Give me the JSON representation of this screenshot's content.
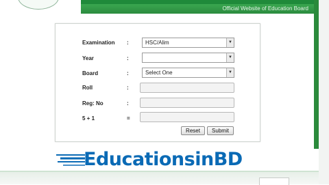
{
  "header": {
    "subtitle": "Official Website of Education Board",
    "accent_color": "#2c8c3f"
  },
  "form": {
    "examination": {
      "label": "Examination",
      "colon": ":",
      "value": "HSC/Alim"
    },
    "year": {
      "label": "Year",
      "colon": ":",
      "value": ""
    },
    "board": {
      "label": "Board",
      "colon": ":",
      "value": "Select One"
    },
    "roll": {
      "label": "Roll",
      "colon": ":",
      "value": ""
    },
    "reg_no": {
      "label": "Reg: No",
      "colon": ":",
      "value": ""
    },
    "captcha": {
      "label": "5 + 1",
      "colon": "=",
      "value": ""
    },
    "dropdown_arrow": "▼",
    "reset_label": "Reset",
    "submit_label": "Submit"
  },
  "watermark": {
    "text": "EducationsinBD",
    "color": "#0a6ab5"
  }
}
